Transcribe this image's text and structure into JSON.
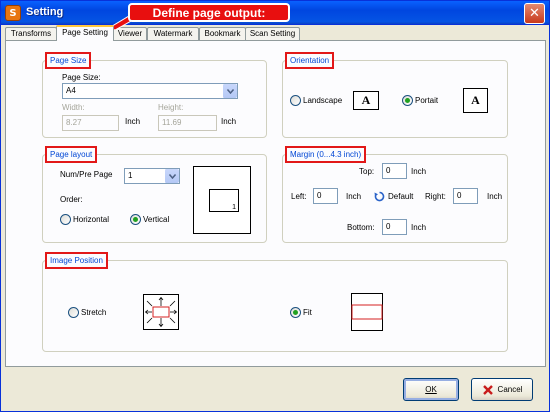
{
  "window": {
    "title": "Setting",
    "icon": "app-setting-icon"
  },
  "callout": {
    "text": "Define page output:"
  },
  "tabs": [
    {
      "label": "Transforms",
      "active": false
    },
    {
      "label": "Page Setting",
      "active": true
    },
    {
      "label": "Viewer",
      "active": false
    },
    {
      "label": "Watermark",
      "active": false
    },
    {
      "label": "Bookmark",
      "active": false
    },
    {
      "label": "Scan Setting",
      "active": false
    }
  ],
  "page_size": {
    "title": "Page Size",
    "size_label": "Page Size:",
    "size_value": "A4",
    "width_label": "Width:",
    "width_value": "8.27",
    "width_unit": "Inch",
    "height_label": "Height:",
    "height_value": "11.69",
    "height_unit": "Inch"
  },
  "orientation": {
    "title": "Orientation",
    "landscape_label": "Landscape",
    "portrait_label": "Portait",
    "selected": "portrait",
    "icon_letter": "A"
  },
  "page_layout": {
    "title": "Page layout",
    "num_label": "Num/Pre Page",
    "num_value": "1",
    "order_label": "Order:",
    "horizontal_label": "Horizontal",
    "vertical_label": "Vertical",
    "selected": "vertical",
    "preview_page_number": "1"
  },
  "margin": {
    "title": "Margin (0...4.3 inch)",
    "top_label": "Top:",
    "top_value": "0",
    "top_unit": "Inch",
    "left_label": "Left:",
    "left_value": "0",
    "left_unit": "Inch",
    "default_label": "Default",
    "right_label": "Right:",
    "right_value": "0",
    "right_unit": "Inch",
    "bottom_label": "Bottom:",
    "bottom_value": "0",
    "bottom_unit": "Inch"
  },
  "image_position": {
    "title": "Image Position",
    "stretch_label": "Stretch",
    "fit_label": "Fit",
    "selected": "fit"
  },
  "buttons": {
    "ok": "OK",
    "cancel": "Cancel"
  },
  "colors": {
    "accent_red": "#e21818",
    "title_blue": "#0046d5",
    "titlebar": "#0554e4",
    "radio_checked": "#21a121"
  }
}
